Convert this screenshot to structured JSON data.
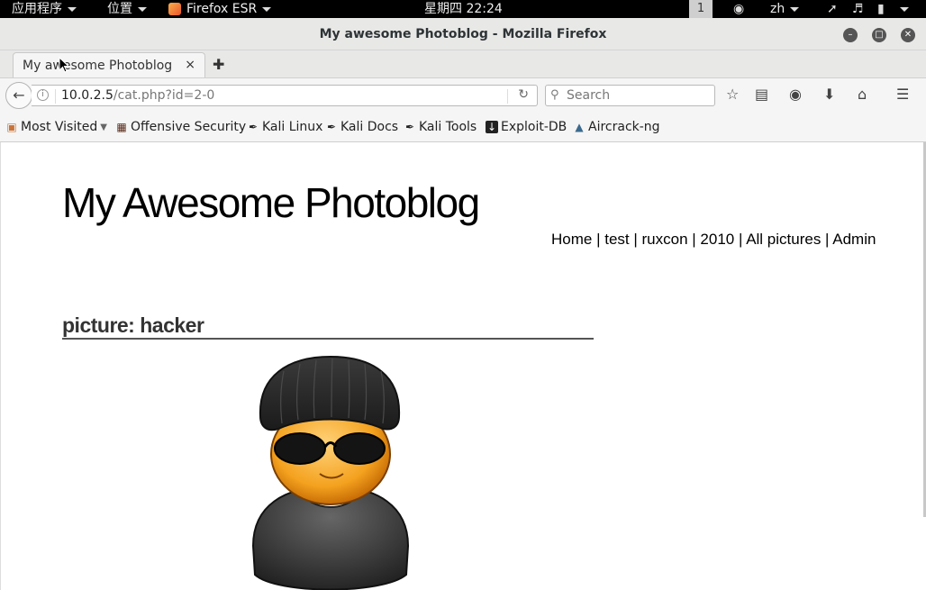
{
  "system_bar": {
    "apps_menu": "应用程序",
    "places_menu": "位置",
    "active_app": "Firefox ESR",
    "clock": "星期四 22:24",
    "workspace": "1",
    "input_method": "zh"
  },
  "window": {
    "title": "My awesome Photoblog - Mozilla Firefox"
  },
  "tabs": [
    {
      "label": "My awesome Photoblog",
      "close": "×"
    }
  ],
  "navbar": {
    "url_host": "10.0.2.5",
    "url_path": "/cat.php?id=2-0",
    "search_placeholder": "Search"
  },
  "bookmarks": [
    {
      "label": "Most Visited",
      "icon": "most-visited-icon"
    },
    {
      "label": "Offensive Security",
      "icon": "offsec-icon"
    },
    {
      "label": "Kali Linux",
      "icon": "kali-icon"
    },
    {
      "label": "Kali Docs",
      "icon": "kali-icon"
    },
    {
      "label": "Kali Tools",
      "icon": "kali-icon"
    },
    {
      "label": "Exploit-DB",
      "icon": "exploitdb-icon"
    },
    {
      "label": "Aircrack-ng",
      "icon": "aircrack-icon"
    }
  ],
  "page": {
    "site_title": "My Awesome Photoblog",
    "nav": [
      "Home",
      "test",
      "ruxcon",
      "2010",
      "All pictures",
      "Admin"
    ],
    "picture_heading": "picture: hacker"
  }
}
